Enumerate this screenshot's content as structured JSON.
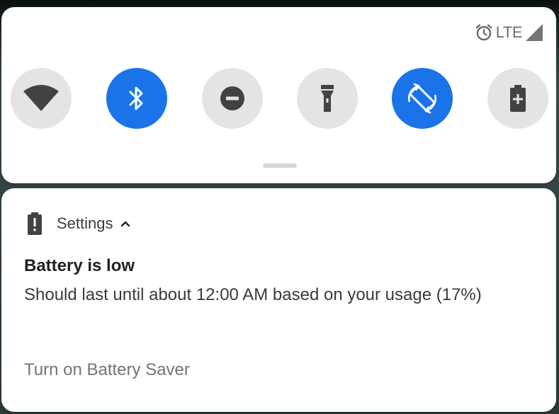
{
  "status_bar": {
    "alarm_icon": "alarm-clock-icon",
    "network_label": "LTE",
    "signal_icon": "cell-signal-icon"
  },
  "quick_settings": {
    "tiles": [
      {
        "name": "wifi",
        "icon": "wifi-icon",
        "active": false
      },
      {
        "name": "bluetooth",
        "icon": "bluetooth-icon",
        "active": true
      },
      {
        "name": "do-not-disturb",
        "icon": "do-not-disturb-icon",
        "active": false
      },
      {
        "name": "flashlight",
        "icon": "flashlight-icon",
        "active": false
      },
      {
        "name": "auto-rotate",
        "icon": "auto-rotate-icon",
        "active": true
      },
      {
        "name": "battery-saver",
        "icon": "battery-saver-icon",
        "active": false
      }
    ],
    "colors": {
      "active": "#1a73e8",
      "inactive": "#e4e4e4",
      "icon_dark": "#424242"
    }
  },
  "notification": {
    "app_icon": "battery-alert-icon",
    "app_name": "Settings",
    "expand_icon": "chevron-up-icon",
    "title": "Battery is low",
    "body": "Should last until about 12:00 AM based on your usage (17%)",
    "action": "Turn on Battery Saver"
  }
}
